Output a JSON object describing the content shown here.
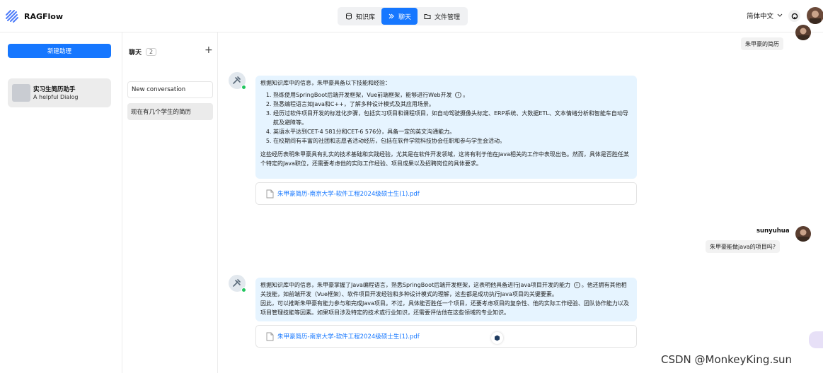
{
  "app": {
    "name": "RAGFlow"
  },
  "nav": {
    "knowledge": "知识库",
    "chat": "聊天",
    "files": "文件管理"
  },
  "header": {
    "language": "简体中文"
  },
  "left": {
    "new_button": "新建助理",
    "dialogs": [
      {
        "name": "实习生简历助手",
        "desc": "A helpful Dialog"
      }
    ]
  },
  "mid": {
    "title": "聊天",
    "count": "2",
    "conversations": [
      "New conversation",
      "现在有几个学生的简历"
    ]
  },
  "messages": {
    "user1": {
      "text": "朱甲豪的简历"
    },
    "bot1": {
      "intro": "根据知识库中的信息，朱甲豪具备以下技能和经验：",
      "items": [
        "熟练使用SpringBoot后端开发框架，Vue前端框架，能够进行Web开发",
        "熟悉编程语言如Java和C++，了解多种设计模式及其应用场景。",
        "经历过软件项目开发的标准化步骤，包括实习项目和课程项目，如自动驾驶摄像头标定、ERP系统、大数据ETL、文本情绪分析和智能车自动导航及避障等。",
        "英语水平达到CET-4 581分和CET-6 576分，具备一定的英文沟通能力。",
        "在校期间有丰富的社团和志愿者活动经历，包括在软件学院科技协会任职和参与学生会活动。"
      ],
      "item1_tail": "。",
      "summary": "这些经历表明朱甲豪具有扎实的技术基础和实践经验，尤其是在软件开发领域，这将有利于他在Java相关的工作中表现出色。然而，具体是否胜任某个特定的Java职位，还需要考虑他的实际工作经验、项目成果以及招聘岗位的具体要求。",
      "doc": "朱甲豪简历-南京大学-软件工程2024级硕士生(1).pdf"
    },
    "user2": {
      "name": "sunyuhua",
      "text": "朱甲豪能做java的项目吗?"
    },
    "bot2": {
      "p1a": "根据知识库中的信息，朱甲豪掌握了Java编程语言，熟悉SpringBoot后端开发框架，这表明他具备进行Java项目开发的能力",
      "p1b": "。他还拥有其他相关技能，如前端开发（Vue框架）、软件项目开发经验和多种设计模式的理解，这些都是成功执行Java项目的关键要素。",
      "p2": "因此，可以推断朱甲豪有能力参与和完成Java项目。不过，具体能否胜任一个项目，还要考虑项目的复杂性、他的实际工作经验、团队协作能力以及项目管理技能等因素。如果项目涉及特定的技术或行业知识，还需要评估他在这些领域的专业知识。",
      "doc": "朱甲豪简历-南京大学-软件工程2024级硕士生(1).pdf"
    }
  },
  "watermark": "CSDN @MonkeyKing.sun",
  "colors": {
    "accent": "#1677ff",
    "bot_bubble": "#e6f4ff",
    "online": "#22c55e"
  }
}
